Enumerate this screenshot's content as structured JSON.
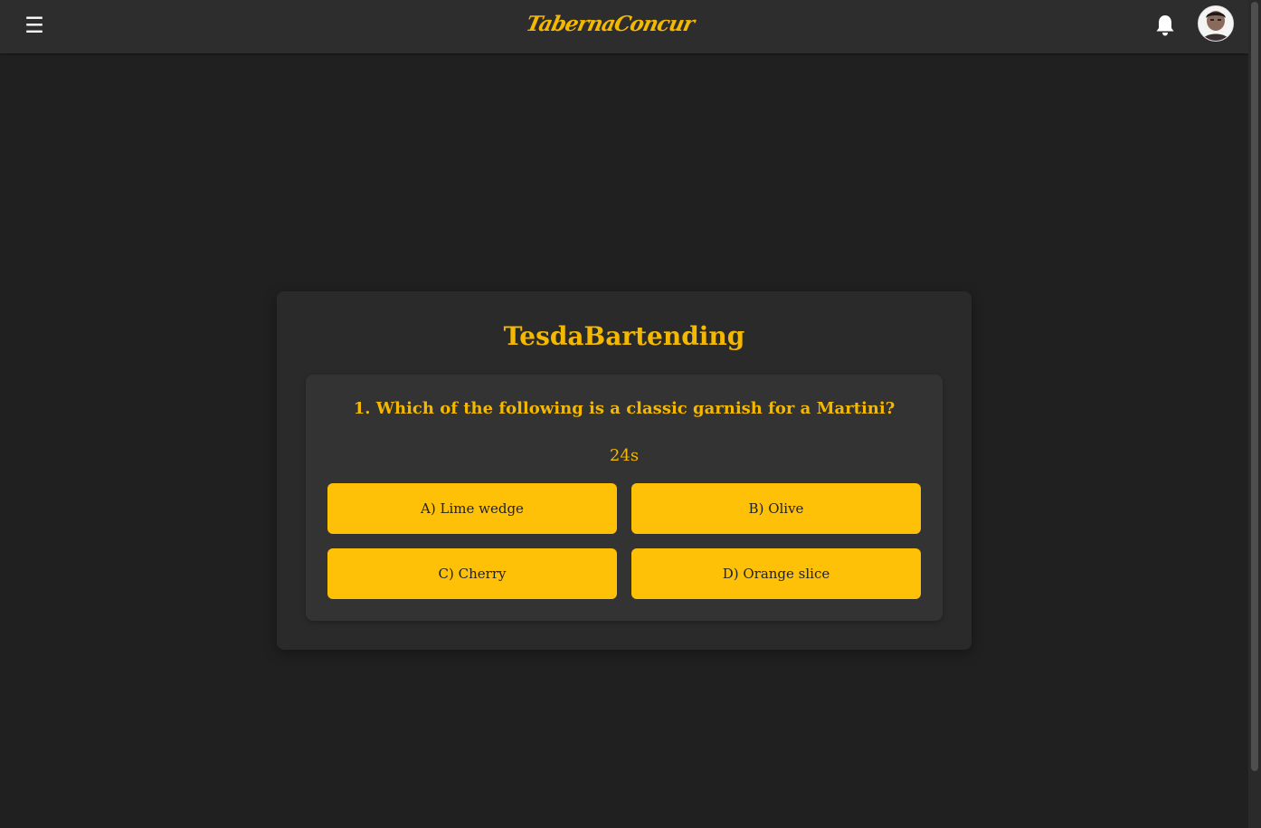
{
  "header": {
    "menu_icon": "hamburger-menu-icon",
    "menu_glyph": "☰",
    "brand": "TabernaConcur",
    "notification_icon": "bell-icon",
    "avatar_icon": "user-avatar"
  },
  "quiz": {
    "title": "TesdaBartending",
    "question": "1. Which of the following is a classic garnish for a Martini?",
    "timer": "24s",
    "options": [
      {
        "label": "A) Lime wedge"
      },
      {
        "label": "B) Olive"
      },
      {
        "label": "C) Cherry"
      },
      {
        "label": "D) Orange slice"
      }
    ]
  },
  "colors": {
    "accent": "#f5b800",
    "button": "#ffc107",
    "background": "#202020",
    "header": "#2d2d2d",
    "card": "#2a2a2a",
    "panel": "#333333"
  }
}
